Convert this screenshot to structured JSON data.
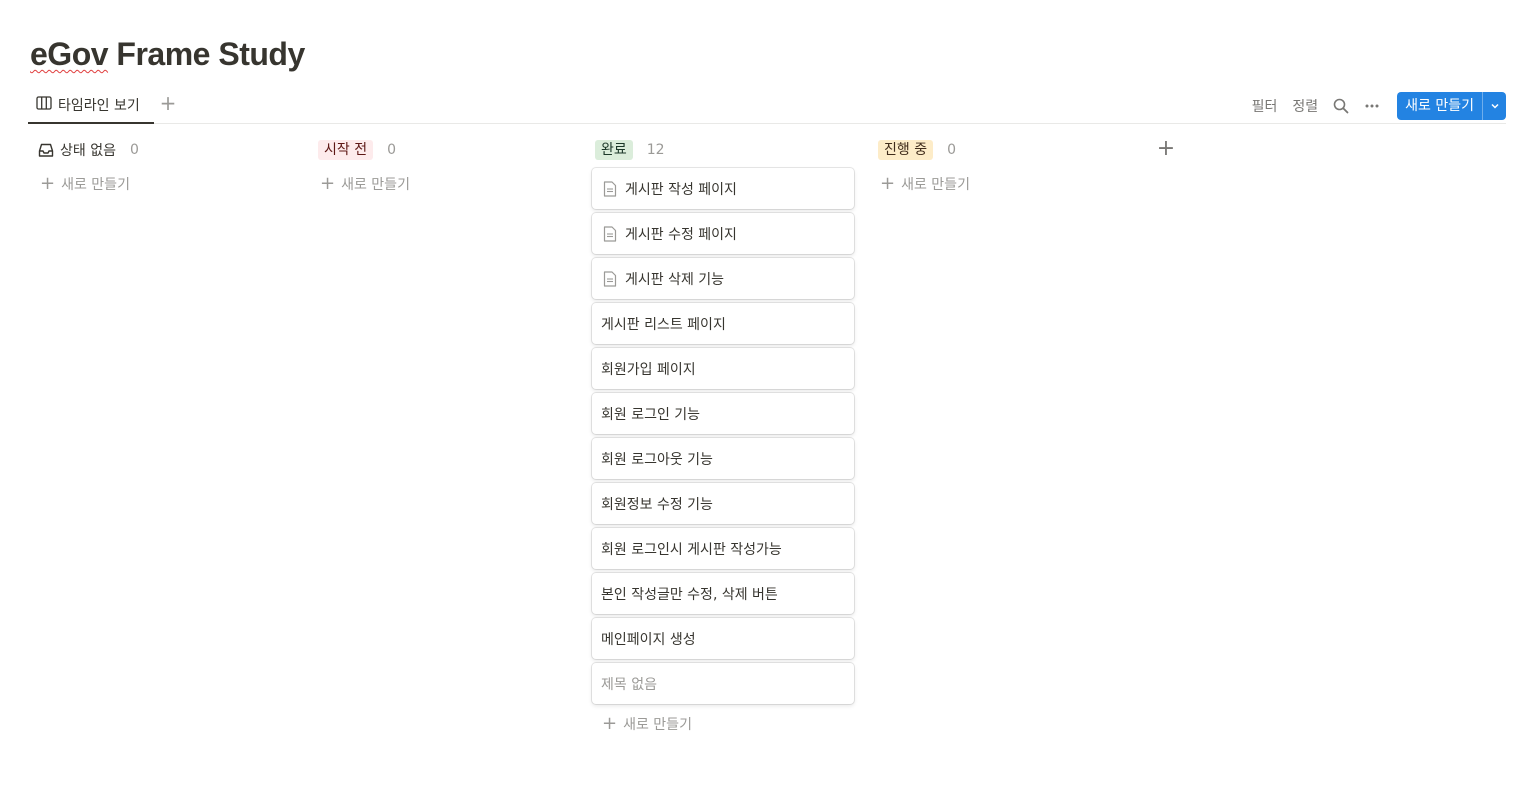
{
  "page": {
    "title": "eGov Frame Study"
  },
  "toolbar": {
    "view_tab_label": "타임라인 보기",
    "add_view": "+",
    "filter_label": "필터",
    "sort_label": "정렬",
    "new_button_label": "새로 만들기"
  },
  "colors": {
    "accent": "#2383e2",
    "tag_not_started_bg": "#fdebec",
    "tag_not_started_fg": "#5d1715",
    "tag_done_bg": "#dbeddb",
    "tag_done_fg": "#1c3829",
    "tag_in_progress_bg": "#fdecc8",
    "tag_in_progress_fg": "#402c1b"
  },
  "board": {
    "new_item_label": "새로 만들기",
    "add_group": "+",
    "columns": [
      {
        "name": "상태 없음",
        "count": "0",
        "icon": "inbox-icon"
      },
      {
        "name": "시작 전",
        "count": "0"
      },
      {
        "name": "완료",
        "count": "12",
        "cards": [
          {
            "title": "게시판 작성 페이지",
            "icon": "document-icon"
          },
          {
            "title": "게시판 수정 페이지",
            "icon": "document-icon"
          },
          {
            "title": "게시판 삭제 기능",
            "icon": "document-icon"
          },
          {
            "title": "게시판 리스트 페이지"
          },
          {
            "title": "회원가입 페이지"
          },
          {
            "title": "회원 로그인 기능"
          },
          {
            "title": "회원 로그아웃 기능"
          },
          {
            "title": "회원정보 수정 기능"
          },
          {
            "title": "회원 로그인시 게시판 작성가능"
          },
          {
            "title": "본인 작성글만 수정, 삭제 버튼"
          },
          {
            "title": "메인페이지 생성"
          },
          {
            "title": "제목 없음"
          }
        ]
      },
      {
        "name": "진행 중",
        "count": "0"
      }
    ]
  }
}
